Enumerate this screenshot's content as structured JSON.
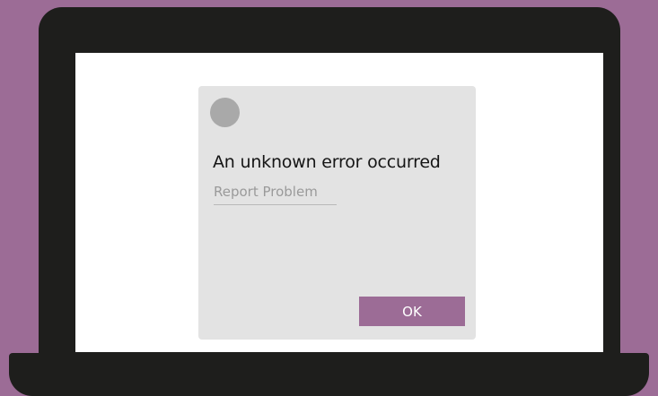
{
  "dialog": {
    "title": "An unknown error occurred",
    "report_link": "Report Problem",
    "ok_label": "OK"
  },
  "colors": {
    "background": "#9c6c96",
    "laptop": "#1e1e1c",
    "screen": "#ffffff",
    "dialog": "#e3e3e3",
    "icon": "#a9a9a9",
    "accent": "#9c6c96"
  },
  "icons": {
    "dialog_icon": "placeholder-circle-icon"
  }
}
